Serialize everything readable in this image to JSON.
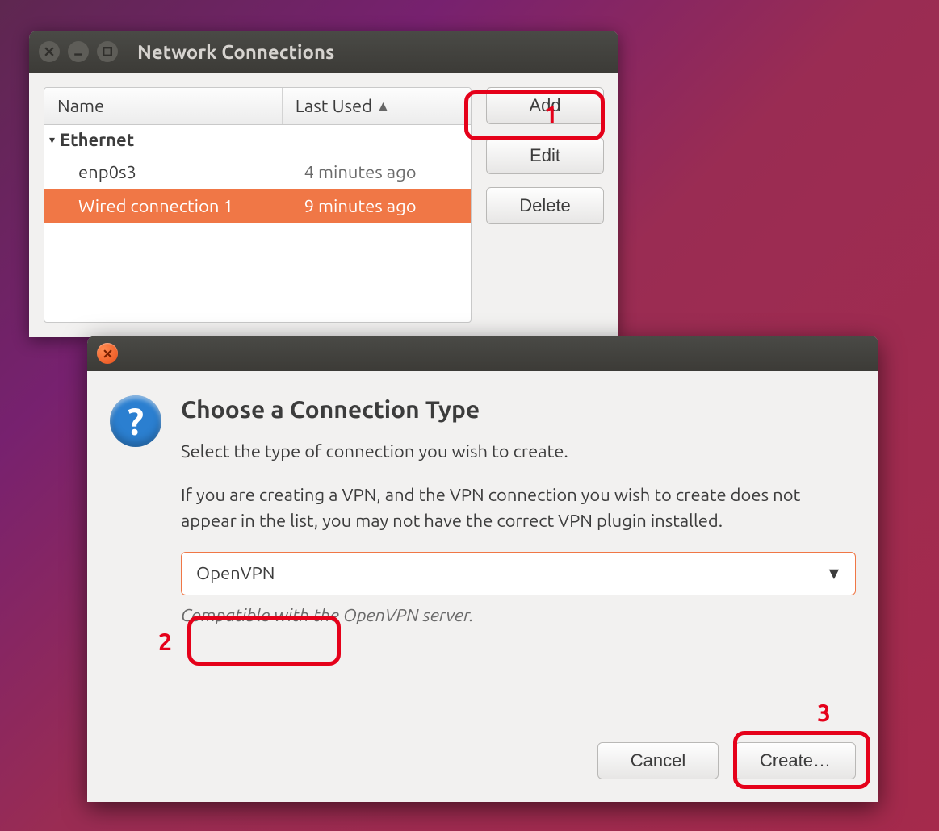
{
  "window1": {
    "title": "Network Connections",
    "columns": {
      "name": "Name",
      "last_used": "Last Used"
    },
    "group_label": "Ethernet",
    "rows": [
      {
        "name": "enp0s3",
        "last_used": "4 minutes ago",
        "selected": false
      },
      {
        "name": "Wired connection 1",
        "last_used": "9 minutes ago",
        "selected": true
      }
    ],
    "buttons": {
      "add": "Add",
      "edit": "Edit",
      "delete": "Delete"
    }
  },
  "dialog": {
    "title": "Choose a Connection Type",
    "text1": "Select the type of connection you wish to create.",
    "text2": "If you are creating a VPN, and the VPN connection you wish to create does not appear in the list, you may not have the correct VPN plugin installed.",
    "selected_type": "OpenVPN",
    "helper": "Compatible with the OpenVPN server.",
    "buttons": {
      "cancel": "Cancel",
      "create": "Create…"
    }
  },
  "annotations": {
    "a1": "1",
    "a2": "2",
    "a3": "3"
  }
}
